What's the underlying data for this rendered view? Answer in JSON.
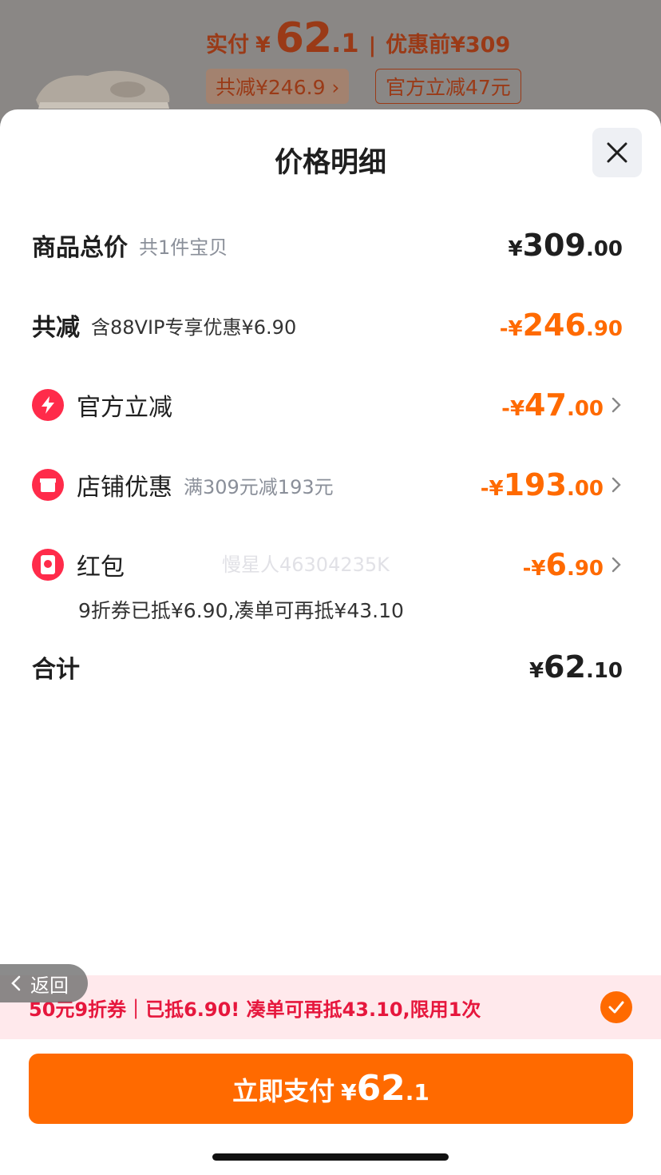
{
  "header": {
    "paid_label": "实付",
    "paid_currency": "¥",
    "paid_int": "62",
    "paid_dec": ".1",
    "separator": "|",
    "before_label": "优惠前¥309",
    "chip_total_reduce": "共减¥246.9 ›",
    "chip_official": "官方立减47元"
  },
  "sheet": {
    "title": "价格明细",
    "close_icon": "close-icon"
  },
  "rows": {
    "total": {
      "label": "商品总价",
      "sub": "共1件宝贝",
      "cur": "¥",
      "int": "309",
      "dec": ".00"
    },
    "reduce": {
      "label": "共减",
      "sub": "含88VIP专享优惠¥6.90",
      "cur": "-¥",
      "int": "246",
      "dec": ".90"
    },
    "official": {
      "label": "官方立减",
      "cur": "-¥",
      "int": "47",
      "dec": ".00",
      "icon": "lightning-icon"
    },
    "store": {
      "label": "店铺优惠",
      "sub": "满309元减193元",
      "cur": "-¥",
      "int": "193",
      "dec": ".00",
      "icon": "store-icon"
    },
    "hongbao": {
      "label": "红包",
      "cur": "-¥",
      "int": "6",
      "dec": ".90",
      "icon": "red-envelope-icon",
      "note": "9折券已抵¥6.90,凑单可再抵¥43.10"
    },
    "sum": {
      "label": "合计",
      "cur": "¥",
      "int": "62",
      "dec": ".10"
    }
  },
  "watermark": "慢星人46304235K",
  "promo": {
    "text": "50元9折券｜已抵6.90! 凑单可再抵43.10,限用1次",
    "check_icon": "check-icon"
  },
  "back_button": {
    "label": "返回"
  },
  "pay_button": {
    "label": "立即支付",
    "cur": "¥",
    "int": "62",
    "dec": ".1"
  },
  "colors": {
    "accent": "#ff6a00",
    "promo_red": "#e6173d",
    "icon_red": "#ff2b4a"
  }
}
